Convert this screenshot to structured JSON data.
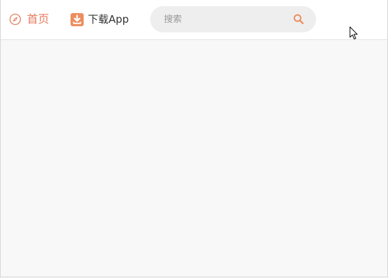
{
  "navbar": {
    "home": {
      "label": "首页",
      "icon": "compass-icon"
    },
    "download": {
      "label": "下载App",
      "icon": "download-app-icon"
    },
    "search": {
      "placeholder": "搜索",
      "value": "",
      "icon": "search-icon"
    }
  },
  "colors": {
    "accent": "#e77b5e",
    "download_icon_bg": "#ec8e5f",
    "search_bg": "#eeeeee",
    "page_bg": "#f8f8f8"
  }
}
